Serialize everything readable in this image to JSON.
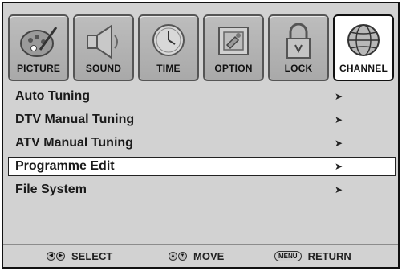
{
  "tabs": [
    {
      "label": "PICTURE",
      "icon": "picture-palette-icon",
      "active": false
    },
    {
      "label": "SOUND",
      "icon": "speaker-icon",
      "active": false
    },
    {
      "label": "TIME",
      "icon": "clock-icon",
      "active": false
    },
    {
      "label": "OPTION",
      "icon": "option-tool-icon",
      "active": false
    },
    {
      "label": "LOCK",
      "icon": "padlock-icon",
      "active": false
    },
    {
      "label": "CHANNEL",
      "icon": "globe-icon",
      "active": true
    }
  ],
  "menu": {
    "items": [
      {
        "label": "Auto Tuning",
        "arrow": "➤",
        "selected": false
      },
      {
        "label": "DTV Manual Tuning",
        "arrow": "➤",
        "selected": false
      },
      {
        "label": "ATV Manual Tuning",
        "arrow": "➤",
        "selected": false
      },
      {
        "label": "Programme Edit",
        "arrow": "➤",
        "selected": true
      },
      {
        "label": "File System",
        "arrow": "➤",
        "selected": false
      }
    ]
  },
  "footer": {
    "select": {
      "keys": [
        "◀",
        "▶"
      ],
      "label": "SELECT"
    },
    "move": {
      "keys": [
        "▲",
        "▼"
      ],
      "label": "MOVE"
    },
    "return": {
      "key": "MENU",
      "label": "RETURN"
    }
  },
  "colors": {
    "panel": "#d2d2d2",
    "tab_inactive": "#bdbdbd",
    "tab_active": "#ffffff",
    "text": "#1a1a1a"
  }
}
